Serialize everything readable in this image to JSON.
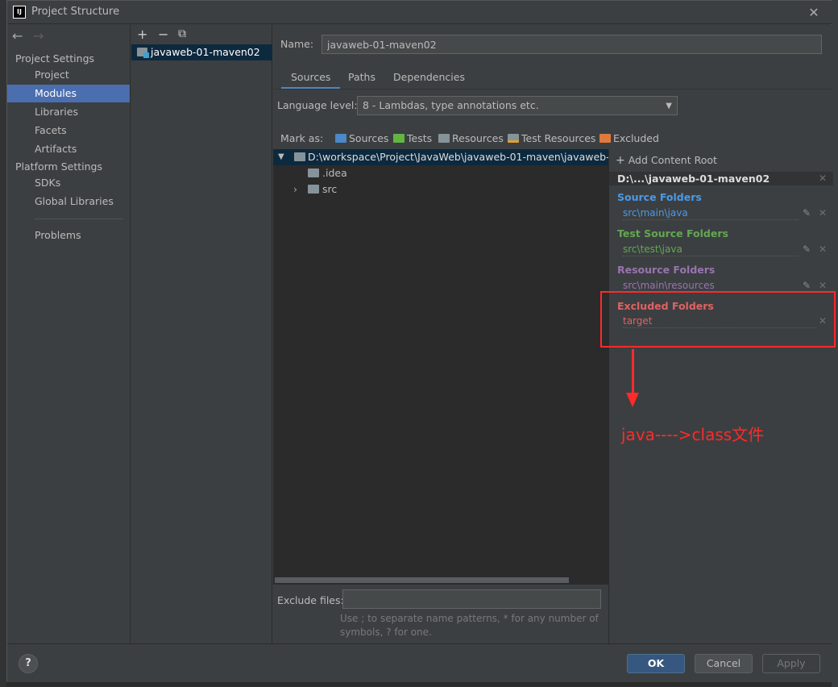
{
  "window": {
    "title": "Project Structure",
    "logo": "IJ"
  },
  "nav": {
    "back": "←",
    "forward": "→",
    "project_settings": "Project Settings",
    "items_project": [
      "Project",
      "Modules",
      "Libraries",
      "Facets",
      "Artifacts"
    ],
    "platform_settings": "Platform Settings",
    "items_platform": [
      "SDKs",
      "Global Libraries"
    ],
    "problems": "Problems",
    "selected": "Modules"
  },
  "modules": {
    "toolbar": {
      "add": "+",
      "remove": "−",
      "copy": "⧉"
    },
    "list": [
      "javaweb-01-maven02"
    ]
  },
  "name": {
    "label": "Name:",
    "value": "javaweb-01-maven02"
  },
  "tabs": [
    "Sources",
    "Paths",
    "Dependencies"
  ],
  "active_tab": "Sources",
  "language_level": {
    "label": "Language level:",
    "value": "8 - Lambdas, type annotations etc."
  },
  "mark_as": {
    "label": "Mark as:",
    "buttons": [
      {
        "label": "Sources",
        "color": "#4a88c7"
      },
      {
        "label": "Tests",
        "color": "#62b543"
      },
      {
        "label": "Resources",
        "color": "#87939a"
      },
      {
        "label": "Test Resources",
        "color": "#87939a"
      },
      {
        "label": "Excluded",
        "color": "#e07a3c"
      }
    ]
  },
  "tree": {
    "root": "D:\\workspace\\Project\\JavaWeb\\javaweb-01-maven\\javaweb-01-",
    "children": [
      ".idea",
      "src"
    ]
  },
  "content_root": {
    "add_label": "Add Content Root",
    "header": "D:\\...\\javaweb-01-maven02",
    "sections": [
      {
        "title": "Source Folders",
        "path": "src\\main\\java",
        "color": "#4a9ae8"
      },
      {
        "title": "Test Source Folders",
        "path": "src\\test\\java",
        "color": "#62a852"
      },
      {
        "title": "Resource Folders",
        "path": "src\\main\\resources",
        "color": "#9874b0"
      },
      {
        "title": "Excluded Folders",
        "path": "target",
        "color": "#e06262"
      }
    ]
  },
  "annotation": "java---->class文件",
  "exclude_files": {
    "label": "Exclude files:",
    "value": "",
    "hint": "Use ; to separate name patterns, * for any number of symbols, ? for one."
  },
  "buttons": {
    "help": "?",
    "ok": "OK",
    "cancel": "Cancel",
    "apply": "Apply"
  }
}
